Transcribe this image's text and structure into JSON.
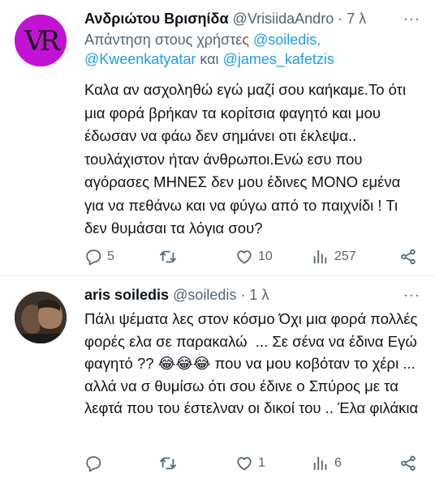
{
  "tweets": [
    {
      "author_name": "Ανδριώτου Βρισηίδα",
      "handle": "@VrisiidaAndro",
      "separator": "·",
      "time": "7 λ",
      "more": "···",
      "avatar_text": "VR",
      "replying_prefix": "Απάντηση στους χρήστες",
      "mentions": [
        "@soiledis,",
        "@Kweenkatyatar",
        "@james_kafetzis"
      ],
      "mention_joiner": "και",
      "body": "Καλα αν ασχοληθώ εγώ μαζί σου καήκαμε.Το ότι μια φορά βρήκαν τα κορίτσια φαγητό και μου έδωσαν να φάω δεν σημάνει οτι έκλεψα.. τουλάχιστον ήταν άνθρωποι.Ενώ εσυ που αγόρασες ΜΗΝΕΣ δεν μου έδινες ΜΟΝΟ εμένα  για να πεθάνω και να φύγω από το παιχνίδι ! Τι δεν θυμάσαι τα λόγια σου?",
      "stats": {
        "replies": "5",
        "retweets": "",
        "likes": "10",
        "views": "257"
      }
    },
    {
      "author_name": "aris soiledis",
      "handle": "@soiledis",
      "separator": "·",
      "time": "1 λ",
      "more": "···",
      "body": "Πάλι ψέματα λες στον κόσμο Όχι μια φορά πολλές φορές ελα σε παρακαλώ  ... Σε σένα να έδινα Εγώ φαγητό ?? 😂😂😂 που να μου κοβόταν το χέρι ... αλλά να σ θυμίσω ότι σου έδινε ο Σπύρος με τα λεφτά που του έστελναν οι δικοί του .. Έλα φιλάκια",
      "stats": {
        "replies": "",
        "retweets": "",
        "likes": "1",
        "views": "6"
      }
    }
  ],
  "colors": {
    "accent": "#1d9bf0",
    "secondary_text": "#536471",
    "primary_text": "#0f1419",
    "avatar1_bg": "#c312d6",
    "divider": "#e6ecf0"
  },
  "icons": [
    "reply-icon",
    "retweet-icon",
    "like-icon",
    "views-icon",
    "share-icon"
  ]
}
